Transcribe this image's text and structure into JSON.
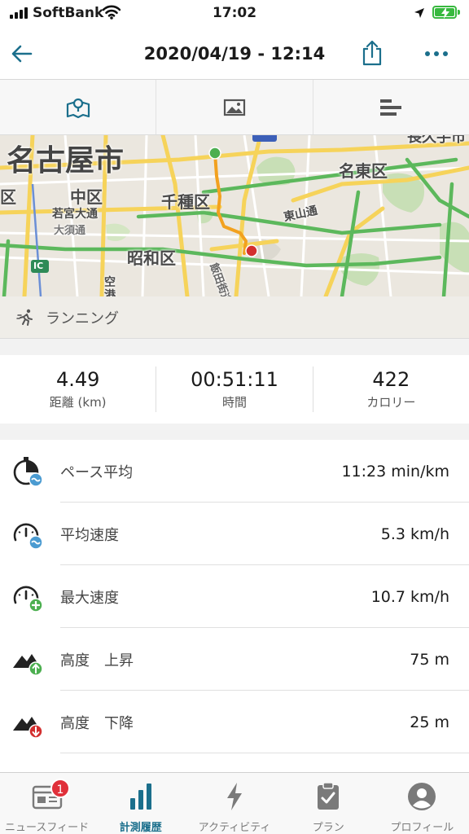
{
  "status_bar": {
    "carrier": "SoftBank",
    "time": "17:02"
  },
  "header": {
    "title": "2020/04/19 - 12:14"
  },
  "view_tabs": [
    "map-icon",
    "photo-icon",
    "bar-list-icon"
  ],
  "map": {
    "labels": {
      "nagoya": "名古屋市",
      "meito": "名東区",
      "naka": "中区",
      "chikusa": "千種区",
      "showa": "昭和区",
      "higashiyama": "東山通",
      "wakamiya": "若宮大通",
      "osu": "大須通",
      "ku": "区",
      "iida": "飯田街道",
      "ic": "IC",
      "sora": "空",
      "minato": "港",
      "top_right": "長久手市"
    },
    "route_colors": {
      "start": "#4caf50",
      "end": "#d32f2f",
      "route": "#f2a11f"
    }
  },
  "activity": {
    "icon": "running-icon",
    "label": "ランニング"
  },
  "summary": [
    {
      "value": "4.49",
      "label": "距離 (km)"
    },
    {
      "value": "00:51:11",
      "label": "時間"
    },
    {
      "value": "422",
      "label": "カロリー"
    }
  ],
  "stats": [
    {
      "icon": "pace-stopwatch-icon",
      "label": "ペース平均",
      "value": "11:23 min/km"
    },
    {
      "icon": "avg-speed-gauge-icon",
      "label": "平均速度",
      "value": "5.3 km/h"
    },
    {
      "icon": "max-speed-gauge-icon",
      "label": "最大速度",
      "value": "10.7 km/h"
    },
    {
      "icon": "elevation-up-icon",
      "label": "高度　上昇",
      "value": "75 m"
    },
    {
      "icon": "elevation-down-icon",
      "label": "高度　下降",
      "value": "25 m"
    }
  ],
  "tab_bar": {
    "items": [
      {
        "label": "ニュースフィード",
        "badge": "1"
      },
      {
        "label": "計測履歴"
      },
      {
        "label": "アクティビティ"
      },
      {
        "label": "プラン"
      },
      {
        "label": "プロフィール"
      }
    ],
    "active": "計測履歴"
  },
  "colors": {
    "accent": "#1b6f8c",
    "badge": "#e0303a",
    "battery": "#38b93f"
  }
}
